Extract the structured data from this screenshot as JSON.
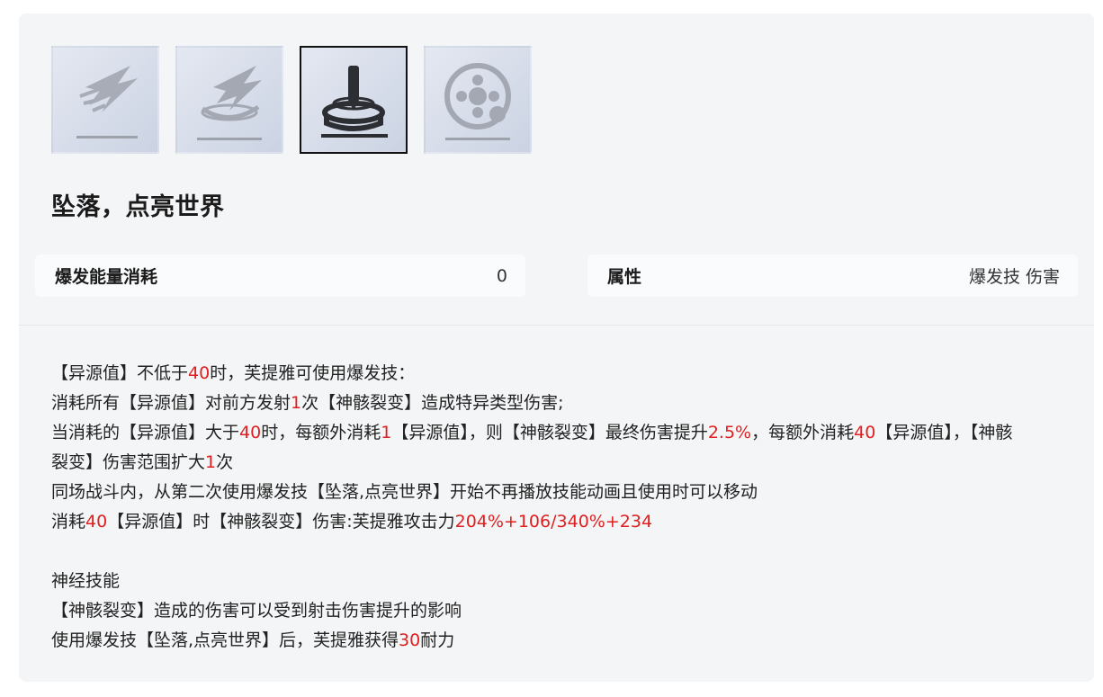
{
  "skill_tabs": [
    {
      "name": "skill-tab-1",
      "icon": "lightning-slash-icon",
      "active": false
    },
    {
      "name": "skill-tab-2",
      "icon": "lightning-ring-icon",
      "active": false
    },
    {
      "name": "skill-tab-3",
      "icon": "drill-impact-icon",
      "active": true
    },
    {
      "name": "skill-tab-4",
      "icon": "target-reticle-icon",
      "active": false
    }
  ],
  "skill": {
    "title": "坠落，点亮世界"
  },
  "stats": {
    "energy": {
      "label": "爆发能量消耗",
      "value": "0"
    },
    "attribute": {
      "label": "属性",
      "value": "爆发技 伤害"
    }
  },
  "colors": {
    "highlight": "#e02020",
    "card": "#f4f5f7",
    "stat_box": "#fafbfc"
  },
  "description": {
    "line1": {
      "a": "【异源值】不低于",
      "n1": "40",
      "b": "时，芙提雅可使用爆发技："
    },
    "line2": {
      "a": "消耗所有【异源值】对前方发射",
      "n1": "1",
      "b": "次【神骸裂变】造成特异类型伤害;"
    },
    "line3": {
      "a": "当消耗的【异源值】大于",
      "n1": "40",
      "b": "时，每额外消耗",
      "n2": "1",
      "c": "【异源值】，则【神骸裂变】最终伤害提升",
      "n3": "2.5%",
      "d": "，每额外消耗",
      "n4": "40",
      "e": "【异源值】，【神骸裂变】伤害范围扩大",
      "n5": "1",
      "f": "次"
    },
    "line4": "同场战斗内，从第二次使用爆发技【坠落,点亮世界】开始不再播放技能动画且使用时可以移动",
    "line5": {
      "a": "消耗",
      "n1": "40",
      "b": "【异源值】时【神骸裂变】伤害:芙提雅攻击力",
      "n2": "204%+106",
      "c": "/",
      "n3": "340%+234"
    },
    "neural_title": "神经技能",
    "neural1": "【神骸裂变】造成的伤害可以受到射击伤害提升的影响",
    "neural2": {
      "a": "使用爆发技【坠落,点亮世界】后，芙提雅获得",
      "n1": "30",
      "b": "耐力"
    }
  }
}
